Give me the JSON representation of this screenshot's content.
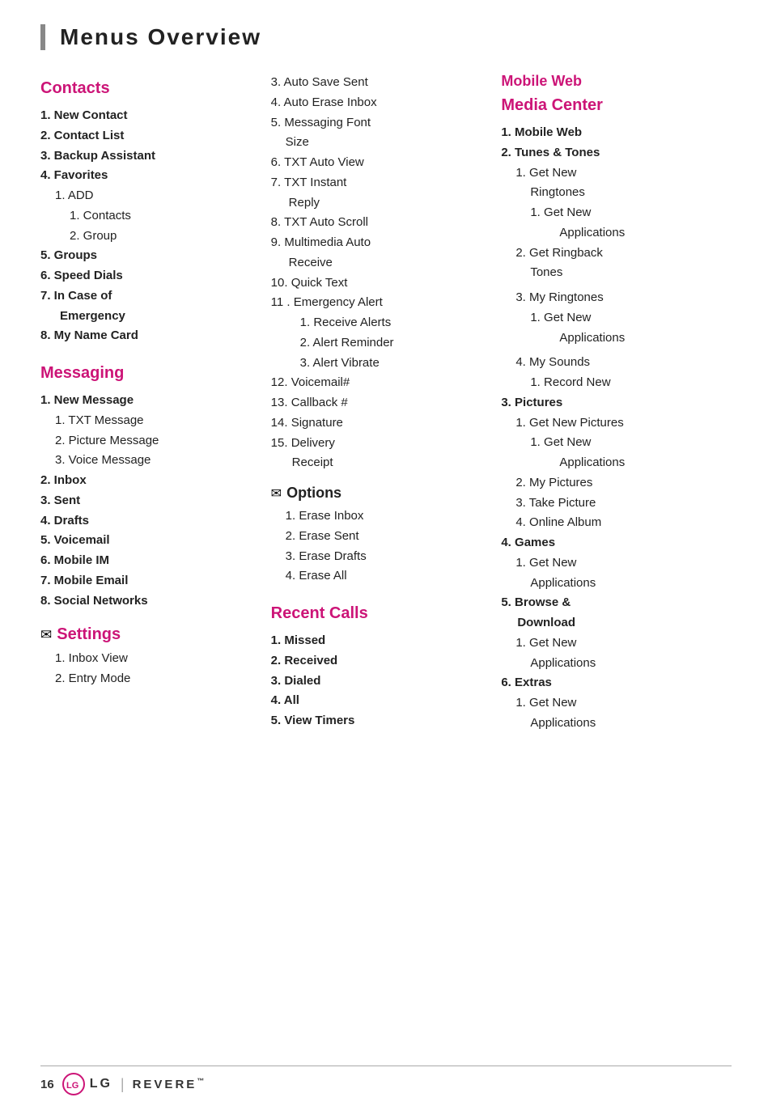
{
  "page": {
    "title": "Menus Overview",
    "footer": {
      "page_number": "16",
      "brand": "LG",
      "model": "REVERE"
    }
  },
  "col1": {
    "contacts": {
      "title": "Contacts",
      "items": [
        {
          "num": "1.",
          "label": "New Contact"
        },
        {
          "num": "2.",
          "label": "Contact List"
        },
        {
          "num": "3.",
          "label": "Backup Assistant"
        },
        {
          "num": "4.",
          "label": "Favorites"
        },
        {
          "sub": "1.",
          "label": "ADD",
          "indent": 1
        },
        {
          "sub": "1.",
          "label": "Contacts",
          "indent": 2
        },
        {
          "sub": "2.",
          "label": "Group",
          "indent": 2
        },
        {
          "num": "5.",
          "label": "Groups"
        },
        {
          "num": "6.",
          "label": "Speed Dials"
        },
        {
          "num": "7.",
          "label": "In Case of Emergency"
        },
        {
          "num": "8.",
          "label": "My Name Card"
        }
      ]
    },
    "messaging": {
      "title": "Messaging",
      "items": [
        {
          "num": "1.",
          "label": "New Message"
        },
        {
          "sub": "1.",
          "label": "TXT Message",
          "indent": 1
        },
        {
          "sub": "2.",
          "label": "Picture Message",
          "indent": 1
        },
        {
          "sub": "3.",
          "label": "Voice Message",
          "indent": 1
        },
        {
          "num": "2.",
          "label": "Inbox"
        },
        {
          "num": "3.",
          "label": "Sent"
        },
        {
          "num": "4.",
          "label": "Drafts"
        },
        {
          "num": "5.",
          "label": "Voicemail"
        },
        {
          "num": "6.",
          "label": "Mobile IM"
        },
        {
          "num": "7.",
          "label": "Mobile Email"
        },
        {
          "num": "8.",
          "label": "Social Networks"
        }
      ]
    },
    "settings": {
      "title": "Settings",
      "items": [
        {
          "num": "1.",
          "label": "Inbox View"
        },
        {
          "num": "2.",
          "label": "Entry Mode"
        }
      ]
    }
  },
  "col2": {
    "messaging_cont": {
      "items": [
        {
          "num": "3.",
          "label": "Auto Save Sent"
        },
        {
          "num": "4.",
          "label": "Auto Erase Inbox"
        },
        {
          "num": "5.",
          "label": "Messaging Font Size"
        },
        {
          "num": "6.",
          "label": "TXT Auto View"
        },
        {
          "num": "7.",
          "label": "TXT Instant Reply"
        },
        {
          "num": "8.",
          "label": "TXT Auto Scroll"
        },
        {
          "num": "9.",
          "label": "Multimedia Auto Receive"
        },
        {
          "num": "10.",
          "label": "Quick Text"
        },
        {
          "num": "11.",
          "label": "Emergency Alert"
        },
        {
          "sub": "1.",
          "label": "Receive Alerts",
          "indent": 1
        },
        {
          "sub": "2.",
          "label": "Alert Reminder",
          "indent": 1
        },
        {
          "sub": "3.",
          "label": "Alert Vibrate",
          "indent": 1
        },
        {
          "num": "12.",
          "label": "Voicemail#"
        },
        {
          "num": "13.",
          "label": "Callback #"
        },
        {
          "num": "14.",
          "label": "Signature"
        },
        {
          "num": "15.",
          "label": "Delivery Receipt"
        }
      ]
    },
    "options": {
      "title": "Options",
      "items": [
        {
          "num": "1.",
          "label": "Erase Inbox"
        },
        {
          "num": "2.",
          "label": "Erase Sent"
        },
        {
          "num": "3.",
          "label": "Erase Drafts"
        },
        {
          "num": "4.",
          "label": "Erase All"
        }
      ]
    },
    "recent_calls": {
      "title": "Recent Calls",
      "items": [
        {
          "num": "1.",
          "label": "Missed"
        },
        {
          "num": "2.",
          "label": "Received"
        },
        {
          "num": "3.",
          "label": "Dialed"
        },
        {
          "num": "4.",
          "label": "All"
        },
        {
          "num": "5.",
          "label": "View Timers"
        }
      ]
    }
  },
  "col3": {
    "mobile_web": {
      "title": "Mobile Web"
    },
    "media_center": {
      "title": "Media Center",
      "items": [
        {
          "num": "1.",
          "label": "Mobile Web"
        },
        {
          "num": "2.",
          "label": "Tunes & Tones"
        },
        {
          "sub": "1.",
          "label": "Get New Ringtones",
          "indent": 1
        },
        {
          "sub": "1.",
          "label": "Get New Applications",
          "indent": 2
        },
        {
          "sub": "2.",
          "label": "Get Ringback Tones",
          "indent": 1
        },
        {
          "sub": "3.",
          "label": "My Ringtones",
          "indent": 1
        },
        {
          "sub": "1.",
          "label": "Get New Applications",
          "indent": 2
        },
        {
          "sub": "4.",
          "label": "My Sounds",
          "indent": 1
        },
        {
          "sub": "1.",
          "label": "Record New",
          "indent": 2
        },
        {
          "num": "3.",
          "label": "Pictures"
        },
        {
          "sub": "1.",
          "label": "Get New Pictures",
          "indent": 1
        },
        {
          "sub": "1.",
          "label": "Get New Applications",
          "indent": 2
        },
        {
          "sub": "2.",
          "label": "My Pictures",
          "indent": 1
        },
        {
          "sub": "3.",
          "label": "Take Picture",
          "indent": 1
        },
        {
          "sub": "4.",
          "label": "Online Album",
          "indent": 1
        },
        {
          "num": "4.",
          "label": "Games"
        },
        {
          "sub": "1.",
          "label": "Get New Applications",
          "indent": 1
        },
        {
          "num": "5.",
          "label": "Browse & Download"
        },
        {
          "sub": "1.",
          "label": "Get New Applications",
          "indent": 1
        },
        {
          "num": "6.",
          "label": "Extras"
        },
        {
          "sub": "1.",
          "label": "Get New Applications",
          "indent": 1
        }
      ]
    }
  }
}
